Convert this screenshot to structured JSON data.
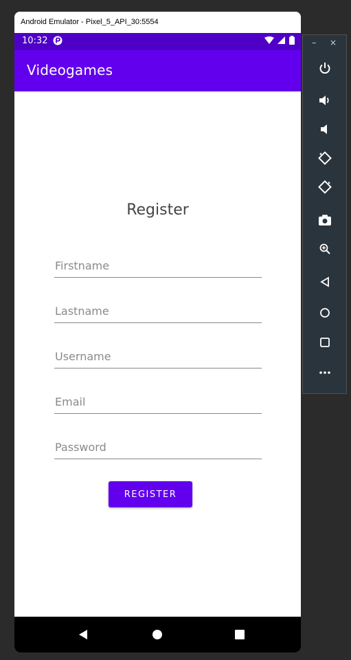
{
  "window": {
    "title": "Android Emulator - Pixel_5_API_30:5554"
  },
  "status_bar": {
    "time": "10:32",
    "app_icon": "notification-app-icon",
    "right_icons": [
      "wifi-icon",
      "signal-icon",
      "battery-icon"
    ]
  },
  "app_bar": {
    "title": "Videogames",
    "color": "#6200ee"
  },
  "form": {
    "heading": "Register",
    "fields": [
      {
        "placeholder": "Firstname",
        "value": ""
      },
      {
        "placeholder": "Lastname",
        "value": ""
      },
      {
        "placeholder": "Username",
        "value": ""
      },
      {
        "placeholder": "Email",
        "value": ""
      },
      {
        "placeholder": "Password",
        "value": ""
      }
    ],
    "submit_label": "REGISTER"
  },
  "nav_bar": {
    "buttons": [
      "back-icon",
      "home-icon",
      "recents-icon"
    ]
  },
  "side_panel": {
    "window_controls": {
      "minimize": "–",
      "close": "×"
    },
    "buttons": [
      "power-icon",
      "volume-up-icon",
      "volume-down-icon",
      "rotate-left-icon",
      "rotate-right-icon",
      "camera-icon",
      "zoom-icon",
      "back-icon",
      "home-icon",
      "overview-icon",
      "more-icon"
    ]
  },
  "colors": {
    "primary": "#6200ee",
    "status_bar": "#4f00c7",
    "emulator_panel": "#2a343c",
    "background": "#2b2b2b"
  }
}
